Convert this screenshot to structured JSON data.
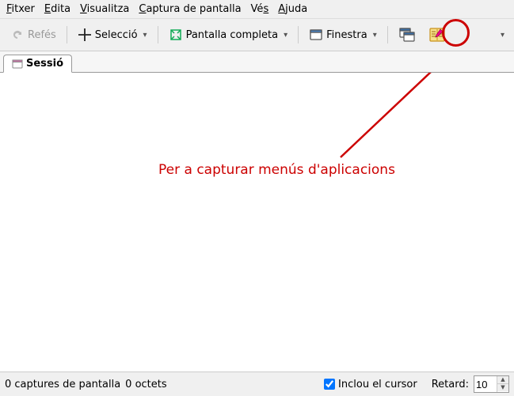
{
  "menubar": {
    "file": "Fitxer",
    "edit": "Edita",
    "view": "Visualitza",
    "capture": "Captura de pantalla",
    "go": "Vés",
    "help": "Ajuda"
  },
  "toolbar": {
    "redo": "Refés",
    "selection": "Selecció",
    "fullscreen": "Pantalla completa",
    "window": "Finestra"
  },
  "tabs": {
    "session": "Sessió"
  },
  "annotation": {
    "text": "Per a capturar menús d'aplicacions"
  },
  "statusbar": {
    "captures": "0 captures de pantalla",
    "bytes": "0 octets",
    "include_cursor": "Inclou el cursor",
    "delay_label": "Retard:",
    "delay_value": "10"
  }
}
